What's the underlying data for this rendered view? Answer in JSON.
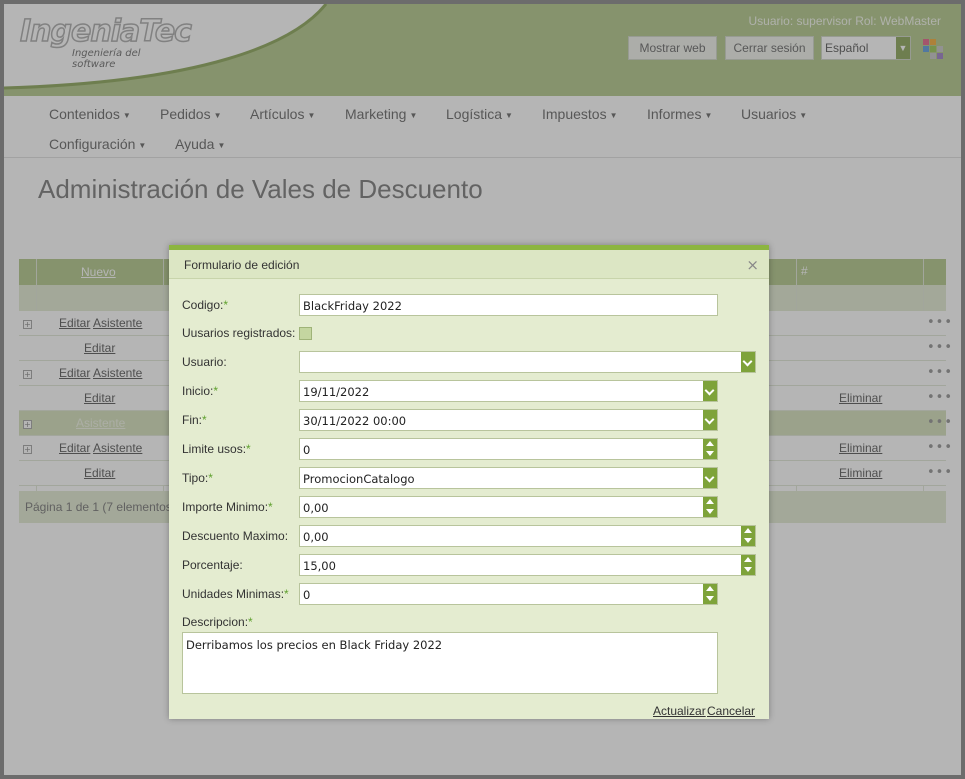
{
  "header": {
    "logo_text": "IngeniaTec",
    "logo_sub": "Ingeniería del software",
    "user_info": "Usuario: supervisor Rol: WebMaster",
    "show_web": "Mostrar web",
    "logout": "Cerrar sesión",
    "language": "Español"
  },
  "menu": {
    "items": [
      "Contenidos",
      "Pedidos",
      "Artículos",
      "Marketing",
      "Logística",
      "Impuestos",
      "Informes",
      "Usuarios",
      "Configuración",
      "Ayuda"
    ]
  },
  "page": {
    "title": "Administración de Vales de Descuento"
  },
  "grid": {
    "new_label": "Nuevo",
    "hash_header": "#",
    "edit": "Editar",
    "wizard": "Asistente",
    "delete": "Eliminar",
    "more": "•••",
    "footer": "Página 1 de 1 (7 elementos"
  },
  "dialog": {
    "title": "Formulario de edición",
    "close": "×",
    "required_mark": "*",
    "fields": {
      "codigo": {
        "label": "Codigo:",
        "value": "BlackFriday 2022"
      },
      "registrados": {
        "label": "Uusarios registrados:"
      },
      "usuario": {
        "label": "Usuario:",
        "value": ""
      },
      "inicio": {
        "label": "Inicio:",
        "value": "19/11/2022"
      },
      "fin": {
        "label": "Fin:",
        "value": "30/11/2022 00:00"
      },
      "limite": {
        "label": "Limite usos:",
        "value": "0"
      },
      "tipo": {
        "label": "Tipo:",
        "value": "PromocionCatalogo"
      },
      "importe": {
        "label": "Importe Minimo:",
        "value": "0,00"
      },
      "descuento": {
        "label": "Descuento Maximo:",
        "value": "0,00"
      },
      "porcentaje": {
        "label": "Porcentaje:",
        "value": "15,00"
      },
      "unidades": {
        "label": "Unidades Minimas:",
        "value": "0"
      },
      "descripcion": {
        "label": "Descripcion:",
        "value": "Derribamos los precios en Black Friday 2022"
      }
    },
    "update": "Actualizar",
    "cancel": "Cancelar"
  },
  "colors": {
    "header_green": "#a9c27c",
    "accent_green": "#8cb540",
    "button_green": "#7ea33a",
    "dialog_bg": "#e4ecd0"
  }
}
